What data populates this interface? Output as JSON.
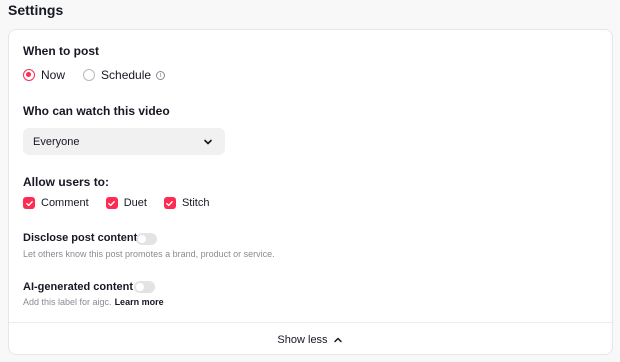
{
  "page": {
    "title": "Settings"
  },
  "when_to_post": {
    "label": "When to post",
    "options": [
      {
        "label": "Now",
        "selected": true
      },
      {
        "label": "Schedule",
        "selected": false
      }
    ],
    "schedule_info_icon": "info-icon"
  },
  "audience": {
    "label": "Who can watch this video",
    "selected": "Everyone"
  },
  "allow": {
    "label": "Allow users to:",
    "options": [
      {
        "label": "Comment",
        "checked": true
      },
      {
        "label": "Duet",
        "checked": true
      },
      {
        "label": "Stitch",
        "checked": true
      }
    ]
  },
  "disclose": {
    "label": "Disclose post content",
    "description": "Let others know this post promotes a brand, product or service.",
    "enabled": false
  },
  "ai_generated": {
    "label": "AI-generated content",
    "description": "Add this label for aigc.",
    "link": "Learn more",
    "enabled": false
  },
  "footer": {
    "show_less": "Show less"
  },
  "colors": {
    "accent": "#fe2c55",
    "toggle_off": "#e3e3e4"
  }
}
